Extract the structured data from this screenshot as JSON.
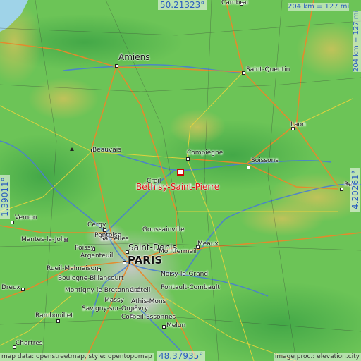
{
  "map": {
    "focus": {
      "name": "Béthisy-Saint-Pierre"
    },
    "coords": {
      "north": "50.21323°",
      "south": "48.37935°",
      "west": "1.39011°",
      "east": "4.20261°"
    },
    "scale": {
      "horizontal": "204 km = 127 mi",
      "vertical": "204 km = 127 mi"
    },
    "attribution": {
      "left": "map data: openstreetmap, style: opentopomap",
      "right": "image proc.: elevation.city"
    },
    "places": [
      {
        "id": "cambrai",
        "name": "Cambrai"
      },
      {
        "id": "amiens",
        "name": "Amiens"
      },
      {
        "id": "saint-quentin",
        "name": "Saint-Quentin"
      },
      {
        "id": "laon",
        "name": "Laon"
      },
      {
        "id": "beauvais",
        "name": "Beauvais"
      },
      {
        "id": "compiegne",
        "name": "Compiègne"
      },
      {
        "id": "soissons",
        "name": "Soissons"
      },
      {
        "id": "reims",
        "name": "Re"
      },
      {
        "id": "creil",
        "name": "Creil"
      },
      {
        "id": "vernon",
        "name": "Vernon"
      },
      {
        "id": "cergy",
        "name": "Cergy"
      },
      {
        "id": "pontoise",
        "name": "Pontoise"
      },
      {
        "id": "goussainville",
        "name": "Goussainville"
      },
      {
        "id": "mantes",
        "name": "Mantes-la-Jolie"
      },
      {
        "id": "sarcelles",
        "name": "Sarcelles"
      },
      {
        "id": "poissy",
        "name": "Poissy"
      },
      {
        "id": "argenteuil",
        "name": "Argenteuil"
      },
      {
        "id": "saint-denis",
        "name": "Saint-Denis"
      },
      {
        "id": "meaux",
        "name": "Meaux"
      },
      {
        "id": "paris",
        "name": "PARIS"
      },
      {
        "id": "montfermeil",
        "name": "Montfermeil"
      },
      {
        "id": "rueil",
        "name": "Rueil-Malmaison"
      },
      {
        "id": "noisy",
        "name": "Noisy-le-Grand"
      },
      {
        "id": "dreux",
        "name": "Dreux"
      },
      {
        "id": "boulogne",
        "name": "Boulogne-Billancourt"
      },
      {
        "id": "montigny",
        "name": "Montigny-le-Bretonneux"
      },
      {
        "id": "creteil",
        "name": "Créteil"
      },
      {
        "id": "pontault",
        "name": "Pontault-Combault"
      },
      {
        "id": "massy",
        "name": "Massy"
      },
      {
        "id": "savigny",
        "name": "Savigny-sur-Orge"
      },
      {
        "id": "athis",
        "name": "Athis-Mons"
      },
      {
        "id": "rambouillet",
        "name": "Rambouillet"
      },
      {
        "id": "evry",
        "name": "Evry"
      },
      {
        "id": "corbeil",
        "name": "Corbeil-Essonnes"
      },
      {
        "id": "melun",
        "name": "Melun"
      },
      {
        "id": "chartres",
        "name": "Chartres"
      }
    ]
  }
}
